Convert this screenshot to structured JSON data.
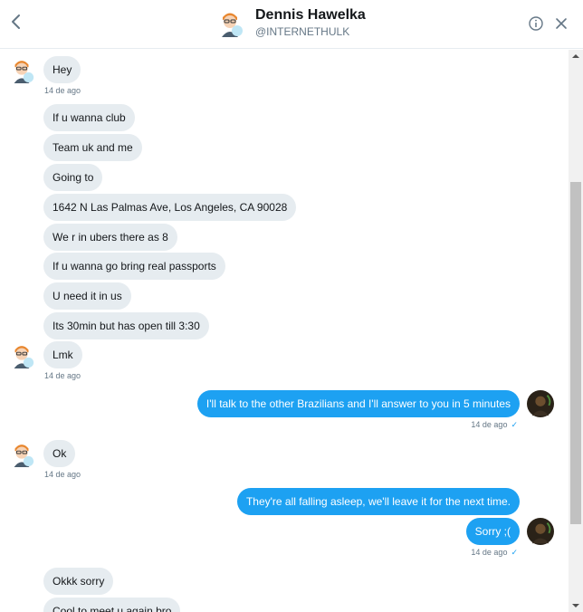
{
  "header": {
    "name": "Dennis Hawelka",
    "handle": "@INTERNETHULK",
    "back_icon": "chevron-left-icon",
    "info_icon": "info-icon",
    "close_icon": "close-icon"
  },
  "colors": {
    "accent": "#1da1f2",
    "incoming_bubble": "#e6ecf0",
    "meta_text": "#657786"
  },
  "messages": [
    {
      "text": "Hey",
      "time": "14 de ago"
    },
    {
      "text": "If u wanna club"
    },
    {
      "text": "Team uk and me"
    },
    {
      "text": "Going to"
    },
    {
      "text": "1642 N Las Palmas Ave, Los Angeles, CA 90028"
    },
    {
      "text": "We r in ubers there as 8"
    },
    {
      "text": "If u wanna go bring real passports"
    },
    {
      "text": "U need it in us"
    },
    {
      "text": "Its 30min but has open till 3:30"
    },
    {
      "text": "Lmk",
      "time": "14 de ago"
    },
    {
      "text": "I'll talk to the other Brazilians and I'll answer to you in 5 minutes",
      "time": "14 de ago"
    },
    {
      "text": "Ok",
      "time": "14 de ago"
    },
    {
      "text": "They're all falling asleep, we'll leave it for the next time."
    },
    {
      "text": "Sorry ;(",
      "time": "14 de ago"
    },
    {
      "text": "Okkk sorry"
    },
    {
      "text": "Cool to meet u again bro"
    }
  ]
}
